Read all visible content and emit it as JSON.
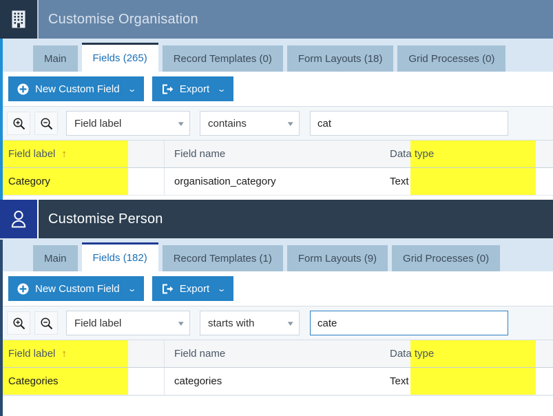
{
  "panels": [
    {
      "id": "organisation",
      "title": "Customise Organisation",
      "icon": "building-icon",
      "tabs": [
        {
          "label": "Main",
          "active": false
        },
        {
          "label": "Fields (265)",
          "active": true
        },
        {
          "label": "Record Templates (0)",
          "active": false
        },
        {
          "label": "Form Layouts (18)",
          "active": false
        },
        {
          "label": "Grid Processes (0)",
          "active": false
        }
      ],
      "toolbar": {
        "new_custom_field_label": "New Custom Field",
        "export_label": "Export",
        "caret": "⌄"
      },
      "filter": {
        "zoom_in_icon": "zoom-in-icon",
        "zoom_out_icon": "zoom-out-icon",
        "field_select_value": "Field label",
        "operator_select_value": "contains",
        "search_value": "cat",
        "search_placeholder": "",
        "search_focused": false
      },
      "grid": {
        "columns": [
          "Field label",
          "Field name",
          "Data type"
        ],
        "sort_column": "Field label",
        "sort_direction": "↑",
        "rows": [
          {
            "field_label": "Category",
            "field_name": "organisation_category",
            "data_type": "Text"
          }
        ]
      }
    },
    {
      "id": "person",
      "title": "Customise Person",
      "icon": "person-icon",
      "tabs": [
        {
          "label": "Main",
          "active": false
        },
        {
          "label": "Fields (182)",
          "active": true
        },
        {
          "label": "Record Templates (1)",
          "active": false
        },
        {
          "label": "Form Layouts (9)",
          "active": false
        },
        {
          "label": "Grid Processes (0)",
          "active": false
        }
      ],
      "toolbar": {
        "new_custom_field_label": "New Custom Field",
        "export_label": "Export",
        "caret": "⌄"
      },
      "filter": {
        "zoom_in_icon": "zoom-in-icon",
        "zoom_out_icon": "zoom-out-icon",
        "field_select_value": "Field label",
        "operator_select_value": "starts with",
        "search_value": "cate",
        "search_placeholder": "",
        "search_focused": true
      },
      "grid": {
        "columns": [
          "Field label",
          "Field name",
          "Data type"
        ],
        "sort_column": "Field label",
        "sort_direction": "↑",
        "rows": [
          {
            "field_label": "Categories",
            "field_name": "categories",
            "data_type": "Text"
          }
        ]
      }
    }
  ],
  "colors": {
    "org_titlebar": "#6585a8",
    "person_titlebar": "#2c3e50",
    "org_icon_box": "#24364a",
    "person_icon_box": "#1f3a93",
    "tabstrip": "#d7e6f2",
    "tab_inactive": "#a5c1d6",
    "tab_active_text": "#1a6fb5",
    "button_blue": "#2583c6",
    "highlight_yellow": "#ffff33",
    "left_strip_org": "#1f8fd6",
    "focus_border": "#2a7fc1"
  }
}
